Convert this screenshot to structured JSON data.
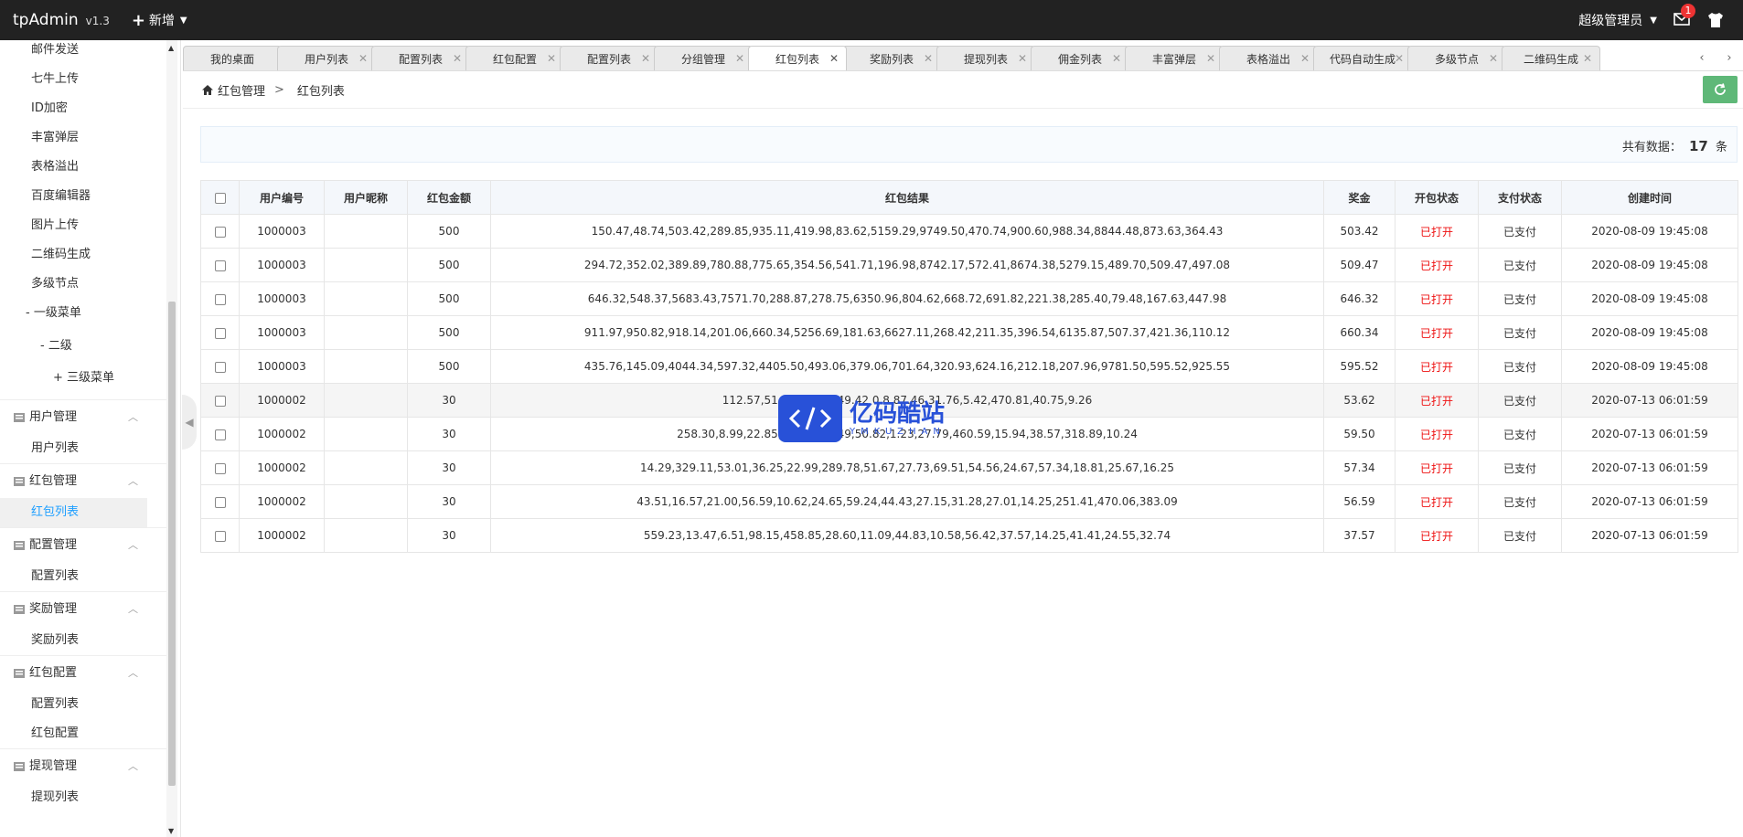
{
  "header": {
    "app_name": "tpAdmin",
    "version": "v1.3",
    "add_label": "新增",
    "admin_label": "超级管理员",
    "mail_badge": "1"
  },
  "sidebar": {
    "top_items": [
      "邮件发送",
      "七牛上传",
      "ID加密",
      "丰富弹层",
      "表格溢出",
      "百度编辑器",
      "图片上传",
      "二维码生成",
      "多级节点"
    ],
    "level1": "- 一级菜单",
    "level2": "- 二级",
    "level3": "+ 三级菜单",
    "groups": [
      {
        "title": "用户管理",
        "items": [
          "用户列表"
        ]
      },
      {
        "title": "红包管理",
        "items": [
          "红包列表"
        ]
      },
      {
        "title": "配置管理",
        "items": [
          "配置列表"
        ]
      },
      {
        "title": "奖励管理",
        "items": [
          "奖励列表"
        ]
      },
      {
        "title": "红包配置",
        "items": [
          "配置列表",
          "红包配置"
        ]
      },
      {
        "title": "提现管理",
        "items": [
          "提现列表"
        ]
      }
    ],
    "active_item": "红包列表"
  },
  "tabs": [
    "我的桌面",
    "用户列表",
    "配置列表",
    "红包配置",
    "配置列表",
    "分组管理",
    "红包列表",
    "奖励列表",
    "提现列表",
    "佣金列表",
    "丰富弹层",
    "表格溢出",
    "代码自动生成",
    "多级节点",
    "二维码生成"
  ],
  "active_tab": "红包列表",
  "breadcrumb": {
    "parent": "红包管理",
    "current": "红包列表",
    "separator": ">"
  },
  "count": {
    "prefix": "共有数据：",
    "value": "17",
    "suffix": "条"
  },
  "table": {
    "headers": [
      "用户编号",
      "用户昵称",
      "红包金额",
      "红包结果",
      "奖金",
      "开包状态",
      "支付状态",
      "创建时间"
    ],
    "rows": [
      [
        "1000003",
        "",
        "500",
        "150.47,48.74,503.42,289.85,935.11,419.98,83.62,5159.29,9749.50,470.74,900.60,988.34,8844.48,873.63,364.43",
        "503.42",
        "已打开",
        "已支付",
        "2020-08-09 19:45:08"
      ],
      [
        "1000003",
        "",
        "500",
        "294.72,352.02,389.89,780.88,775.65,354.56,541.71,196.98,8742.17,572.41,8674.38,5279.15,489.70,509.47,497.08",
        "509.47",
        "已打开",
        "已支付",
        "2020-08-09 19:45:08"
      ],
      [
        "1000003",
        "",
        "500",
        "646.32,548.37,5683.43,7571.70,288.87,278.75,6350.96,804.62,668.72,691.82,221.38,285.40,79.48,167.63,447.98",
        "646.32",
        "已打开",
        "已支付",
        "2020-08-09 19:45:08"
      ],
      [
        "1000003",
        "",
        "500",
        "911.97,950.82,918.14,201.06,660.34,5256.69,181.63,6627.11,268.42,211.35,396.54,6135.87,507.37,421.36,110.12",
        "660.34",
        "已打开",
        "已支付",
        "2020-08-09 19:45:08"
      ],
      [
        "1000003",
        "",
        "500",
        "435.76,145.09,4044.34,597.32,4405.50,493.06,379.06,701.64,320.93,624.16,212.18,207.96,9781.50,595.52,925.55",
        "595.52",
        "已打开",
        "已支付",
        "2020-08-09 19:45:08"
      ],
      [
        "1000002",
        "",
        "30",
        "112.57,51.86,8.39,1 49.42 0.8.87.46,31.76,5.42,470.81,40.75,9.26",
        "53.62",
        "已打开",
        "已支付",
        "2020-07-13 06:01:59"
      ],
      [
        "1000002",
        "",
        "30",
        "258.30,8.99,22.85,59. 30,42.49,50.82,1.23,27.79,460.59,15.94,38.57,318.89,10.24",
        "59.50",
        "已打开",
        "已支付",
        "2020-07-13 06:01:59"
      ],
      [
        "1000002",
        "",
        "30",
        "14.29,329.11,53.01,36.25,22.99,289.78,51.67,27.73,69.51,54.56,24.67,57.34,18.81,25.67,16.25",
        "57.34",
        "已打开",
        "已支付",
        "2020-07-13 06:01:59"
      ],
      [
        "1000002",
        "",
        "30",
        "43.51,16.57,21.00,56.59,10.62,24.65,59.24,44.43,27.15,31.28,27.01,14.25,251.41,470.06,383.09",
        "56.59",
        "已打开",
        "已支付",
        "2020-07-13 06:01:59"
      ],
      [
        "1000002",
        "",
        "30",
        "559.23,13.47,6.51,98.15,458.85,28.60,11.09,44.83,10.58,56.42,37.57,14.25,41.41,24.55,32.74",
        "37.57",
        "已打开",
        "已支付",
        "2020-07-13 06:01:59"
      ]
    ]
  },
  "watermark": {
    "title": "亿码酷站",
    "subtitle": "YMKUZHAN"
  },
  "colors": {
    "accent": "#1e9fff",
    "status_red": "#e11111",
    "refresh_green": "#5fb878",
    "topbar": "#222222"
  }
}
